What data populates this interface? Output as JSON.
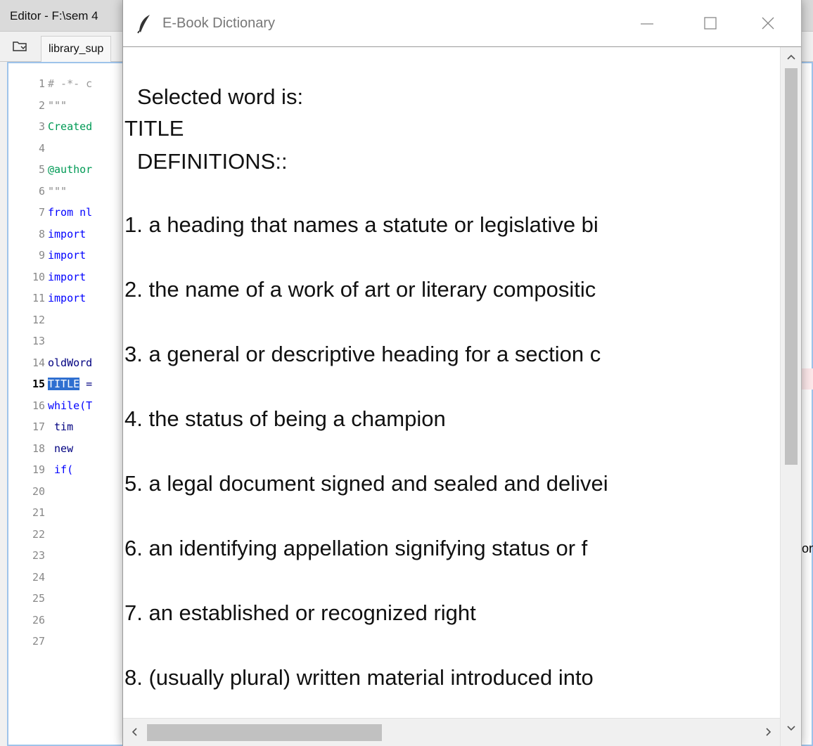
{
  "editor": {
    "title": "Editor - F:\\sem 4",
    "tab": "library_sup",
    "code_lines": [
      {
        "num": "1",
        "text": "# -*- c",
        "cls": "c-comment"
      },
      {
        "num": "2",
        "text": "\"\"\"",
        "cls": "c-str"
      },
      {
        "num": "3",
        "text": "Created",
        "cls": "c-green"
      },
      {
        "num": "4",
        "text": "",
        "cls": ""
      },
      {
        "num": "5",
        "text": "@author",
        "cls": "c-green"
      },
      {
        "num": "6",
        "text": "\"\"\"",
        "cls": "c-str"
      },
      {
        "num": "7",
        "text": "from nl",
        "cls": "c-kw"
      },
      {
        "num": "8",
        "text": "import",
        "cls": "c-kw"
      },
      {
        "num": "9",
        "text": "import",
        "cls": "c-kw"
      },
      {
        "num": "10",
        "text": "import",
        "cls": "c-kw"
      },
      {
        "num": "11",
        "text": "import",
        "cls": "c-kw"
      },
      {
        "num": "12",
        "text": "",
        "cls": ""
      },
      {
        "num": "13",
        "text": "",
        "cls": ""
      },
      {
        "num": "14",
        "text": "oldWord",
        "cls": ""
      },
      {
        "num": "15",
        "text": "TITLE",
        "cls": "c-sel",
        "suffix": " =",
        "current": true
      },
      {
        "num": "16",
        "text": "while(T",
        "cls": "c-kw"
      },
      {
        "num": "17",
        "text": "    tim",
        "cls": ""
      },
      {
        "num": "18",
        "text": "    new",
        "cls": ""
      },
      {
        "num": "19",
        "text": "    if(",
        "cls": "c-kw"
      },
      {
        "num": "20",
        "text": "",
        "cls": ""
      },
      {
        "num": "21",
        "text": "",
        "cls": ""
      },
      {
        "num": "22",
        "text": "",
        "cls": ""
      },
      {
        "num": "23",
        "text": "",
        "cls": ""
      },
      {
        "num": "24",
        "text": "",
        "cls": ""
      },
      {
        "num": "25",
        "text": "",
        "cls": ""
      },
      {
        "num": "26",
        "text": "",
        "cls": ""
      },
      {
        "num": "27",
        "text": "",
        "cls": ""
      }
    ],
    "right_fragment": "on"
  },
  "dialog": {
    "title": "E-Book Dictionary",
    "selected_label": "Selected word is:",
    "word": "TITLE",
    "definitions_label": "DEFINITIONS::",
    "definitions": [
      "1. a heading that names a statute or legislative bi",
      "2. the name of a work of art or literary compositic",
      "3. a general or descriptive heading for a section c",
      "4. the status of being a champion",
      "5. a legal document signed and sealed and delivei",
      "6. an identifying appellation signifying status or f",
      "7. an established or recognized right",
      "8. (usually plural) written material introduced into"
    ]
  }
}
